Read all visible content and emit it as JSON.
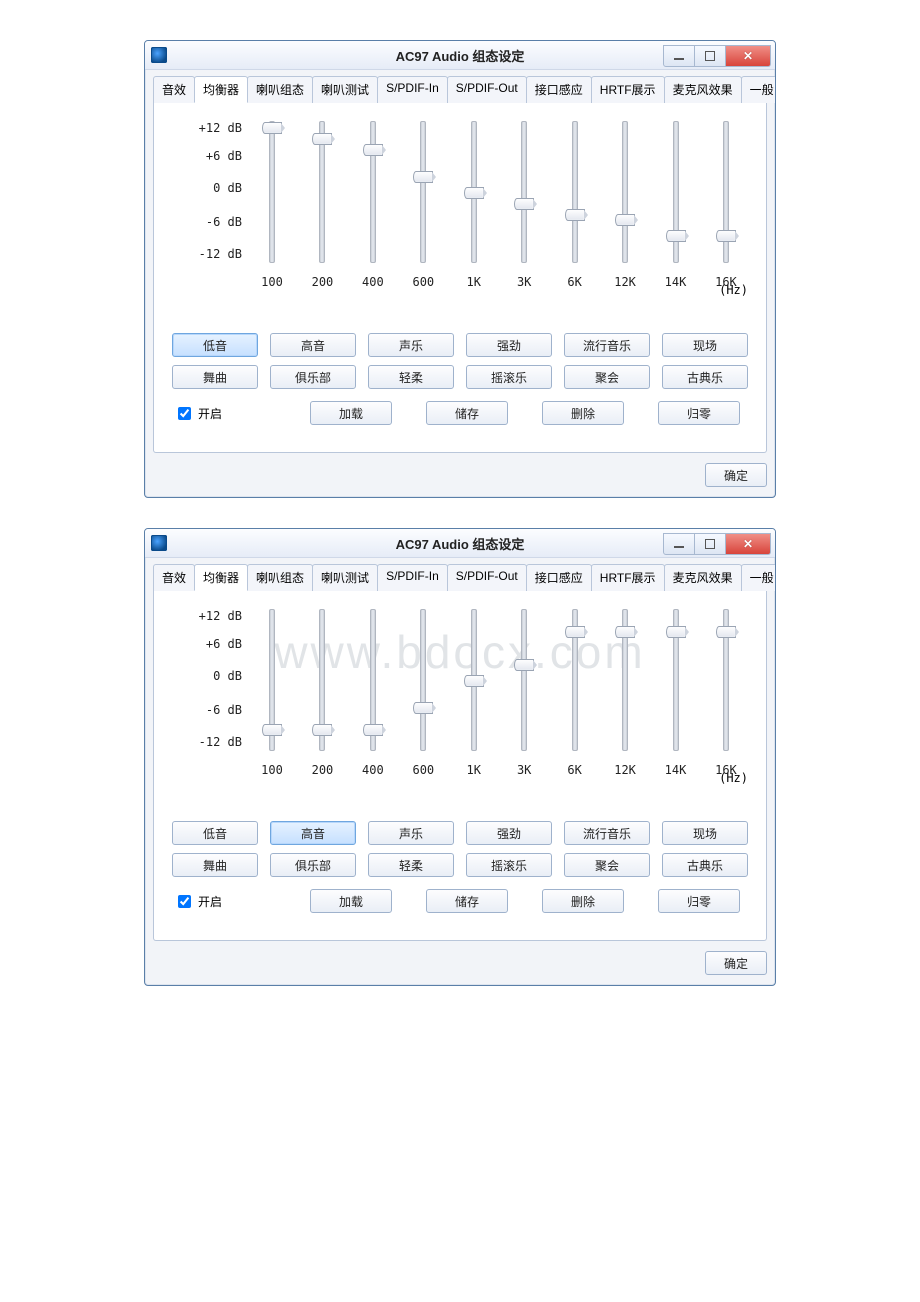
{
  "title": "AC97 Audio 组态设定",
  "tabs": [
    "音效",
    "均衡器",
    "喇叭组态",
    "喇叭测试",
    "S/PDIF-In",
    "S/PDIF-Out",
    "接口感应",
    "HRTF展示",
    "麦克风效果",
    "一般"
  ],
  "active_tab_index": 1,
  "db_labels": [
    "+12 dB",
    "+6 dB",
    "0 dB",
    "-6 dB",
    "-12 dB"
  ],
  "hz_label": "(Hz)",
  "freqs": [
    "100",
    "200",
    "400",
    "600",
    "1K",
    "3K",
    "6K",
    "12K",
    "14K",
    "16K"
  ],
  "presets_row1": [
    "低音",
    "高音",
    "声乐",
    "强劲",
    "流行音乐",
    "现场"
  ],
  "presets_row2": [
    "舞曲",
    "俱乐部",
    "轻柔",
    "摇滚乐",
    "聚会",
    "古典乐"
  ],
  "enable_label": "开启",
  "action_buttons": [
    "加载",
    "储存",
    "删除",
    "归零"
  ],
  "ok_label": "确定",
  "watermark": "www.bdocx.com",
  "window1": {
    "selected_preset_index": 0,
    "slider_db": [
      12,
      10,
      8,
      3,
      0,
      -2,
      -4,
      -5,
      -8,
      -8
    ]
  },
  "window2": {
    "selected_preset_index": 1,
    "slider_db": [
      -9,
      -9,
      -9,
      -5,
      0,
      3,
      9,
      9,
      9,
      9
    ]
  }
}
